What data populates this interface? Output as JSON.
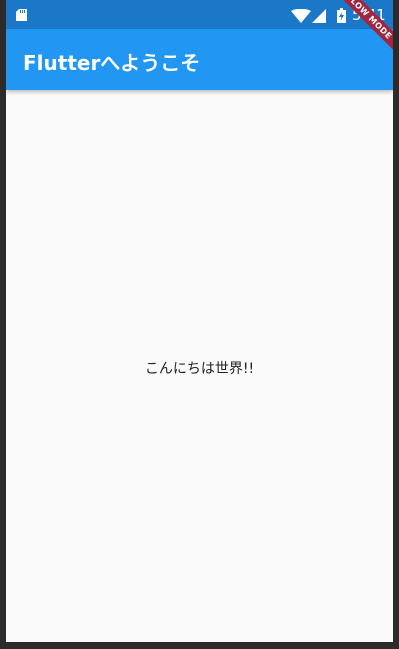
{
  "status_bar": {
    "time": "5:41",
    "icons": [
      "sd-card-icon",
      "wifi-icon",
      "cell-signal-icon",
      "battery-charging-icon"
    ],
    "color": "#1b78c8"
  },
  "app_bar": {
    "title": "Flutterへようこそ",
    "color": "#2196f3"
  },
  "body": {
    "text": "こんにちは世界!!"
  },
  "debug_banner": {
    "label": "SLOW MODE",
    "color": "#a0273f"
  }
}
